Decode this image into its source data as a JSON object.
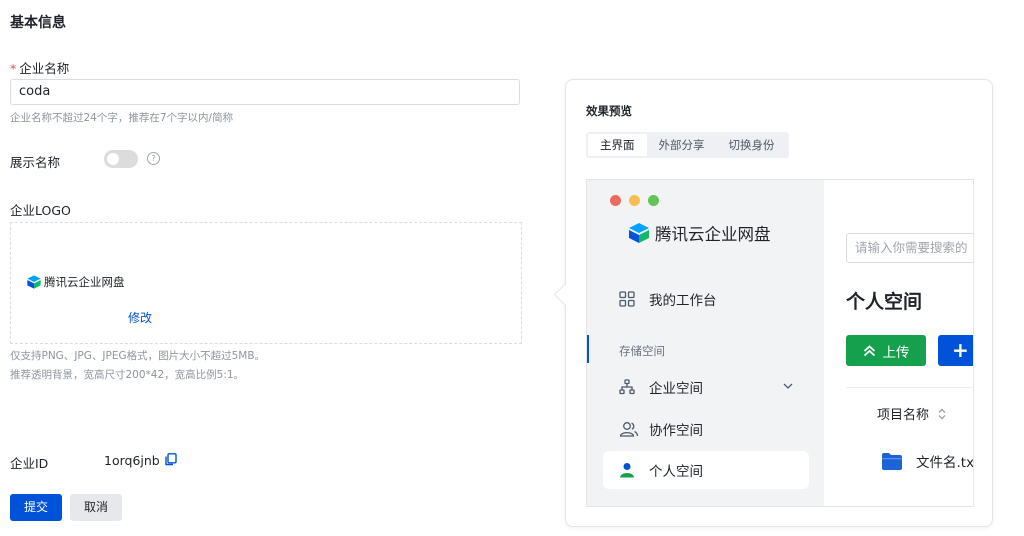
{
  "section_title": "基本信息",
  "company_name": {
    "required_mark": "*",
    "label": "企业名称",
    "value": "coda",
    "hint": "企业名称不超过24个字，推荐在7个字以内/简称"
  },
  "show_name": {
    "label": "展示名称",
    "enabled": false,
    "help_glyph": "?"
  },
  "logo": {
    "label": "企业LOGO",
    "logo_text": "腾讯云企业网盘",
    "edit_link": "修改",
    "hint_line1": "仅支持PNG、JPG、JPEG格式，图片大小不超过5MB。",
    "hint_line2": "推荐透明背景，宽高尺寸200*42，宽高比例5:1。"
  },
  "company_id": {
    "label": "企业ID",
    "value": "1orq6jnb",
    "copy_icon": "copy-icon"
  },
  "actions": {
    "submit": "提交",
    "cancel": "取消"
  },
  "preview": {
    "title": "效果预览",
    "tabs": [
      {
        "label": "主界面",
        "active": true
      },
      {
        "label": "外部分享",
        "active": false
      },
      {
        "label": "切换身份",
        "active": false
      }
    ],
    "window_dots": [
      "#ed6a5e",
      "#f4bf4f",
      "#61c554"
    ],
    "app_name": "腾讯云企业网盘",
    "workbench": "我的工作台",
    "storage_section": "存储空间",
    "nav": {
      "enterprise": "企业空间",
      "collab": "协作空间",
      "personal": "个人空间"
    },
    "search_placeholder": "请输入你需要搜索的",
    "page_heading": "个人空间",
    "upload_button": "上传",
    "new_button": "+",
    "column_header": "项目名称",
    "file_name": "文件名.txt",
    "colors": {
      "primary": "#0052d9",
      "upload_green": "#14a04d",
      "folder": "#1e63d6"
    }
  }
}
